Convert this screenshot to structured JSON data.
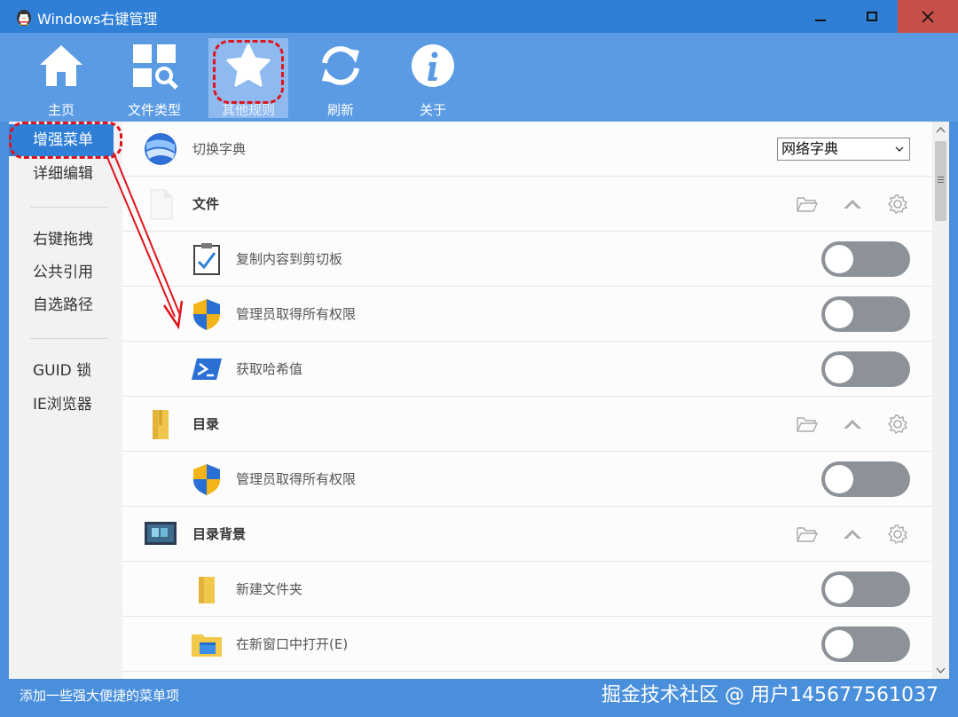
{
  "window": {
    "title": "Windows右键管理"
  },
  "toolbar": {
    "items": [
      {
        "label": "主页",
        "icon": "home-icon"
      },
      {
        "label": "文件类型",
        "icon": "file-types-icon"
      },
      {
        "label": "其他规则",
        "icon": "star-icon",
        "active": true
      },
      {
        "label": "刷新",
        "icon": "refresh-icon"
      },
      {
        "label": "关于",
        "icon": "info-icon"
      }
    ]
  },
  "sidebar": {
    "items": [
      {
        "label": "增强菜单",
        "active": true
      },
      {
        "label": "详细编辑"
      },
      {
        "label": "右键拖拽"
      },
      {
        "label": "公共引用"
      },
      {
        "label": "自选路径"
      },
      {
        "label": "GUID 锁"
      },
      {
        "label": "IE浏览器"
      }
    ]
  },
  "main": {
    "dictionary": {
      "label": "切换字典",
      "selected": "网络字典"
    },
    "groups": [
      {
        "title": "文件",
        "items": [
          {
            "label": "复制内容到剪切板",
            "enabled": false
          },
          {
            "label": "管理员取得所有权限",
            "enabled": false
          },
          {
            "label": "获取哈希值",
            "enabled": false
          }
        ]
      },
      {
        "title": "目录",
        "items": [
          {
            "label": "管理员取得所有权限",
            "enabled": false
          }
        ]
      },
      {
        "title": "目录背景",
        "items": [
          {
            "label": "新建文件夹",
            "enabled": false
          },
          {
            "label": "在新窗口中打开(E)",
            "enabled": false
          }
        ]
      }
    ]
  },
  "status": {
    "message": "添加一些强大便捷的菜单项",
    "watermark": "掘金技术社区 @ 用户145677561037"
  },
  "colors": {
    "title_bar": "#2f7fd6",
    "toolbar": "#5b9be3",
    "accent": "#2f7fd6",
    "close_button": "#c8504b",
    "toggle_off": "#8d9298",
    "annotation": "#e0141c"
  }
}
